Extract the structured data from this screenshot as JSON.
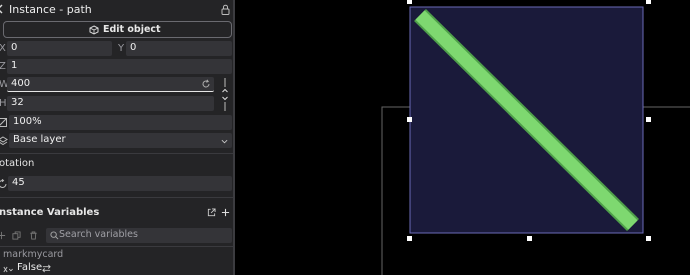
{
  "panel": {
    "instance_title": "Instance  -  path",
    "edit_object_label": "Edit object",
    "fields": {
      "x_label": "X",
      "x_value": "0",
      "y_label": "Y",
      "y_value": "0",
      "z_label": "Z",
      "z_value": "1",
      "w_label": "W",
      "w_value": "400",
      "h_label": "H",
      "h_value": "32",
      "opacity_value": "100%",
      "layer_value": "Base layer"
    },
    "rotation": {
      "title": "otation",
      "value": "45"
    },
    "variables": {
      "title": "nstance Variables",
      "search_placeholder": "Search variables",
      "var_name": "markmycard",
      "var_value": "False"
    }
  },
  "colors": {
    "panel_bg": "#242426",
    "field_bg": "#343438",
    "accent_box": "#1a1a3a",
    "selection": "#6b6bb8",
    "line_green": "#7ed870"
  },
  "icons": {
    "lock": "lock-icon",
    "edit": "cube-edit-icon",
    "search": "search-icon",
    "reset": "reset-icon",
    "link": "link-toggle-icon",
    "dropdown": "chevron-down-icon",
    "external": "open-external-icon",
    "add": "plus-icon"
  }
}
